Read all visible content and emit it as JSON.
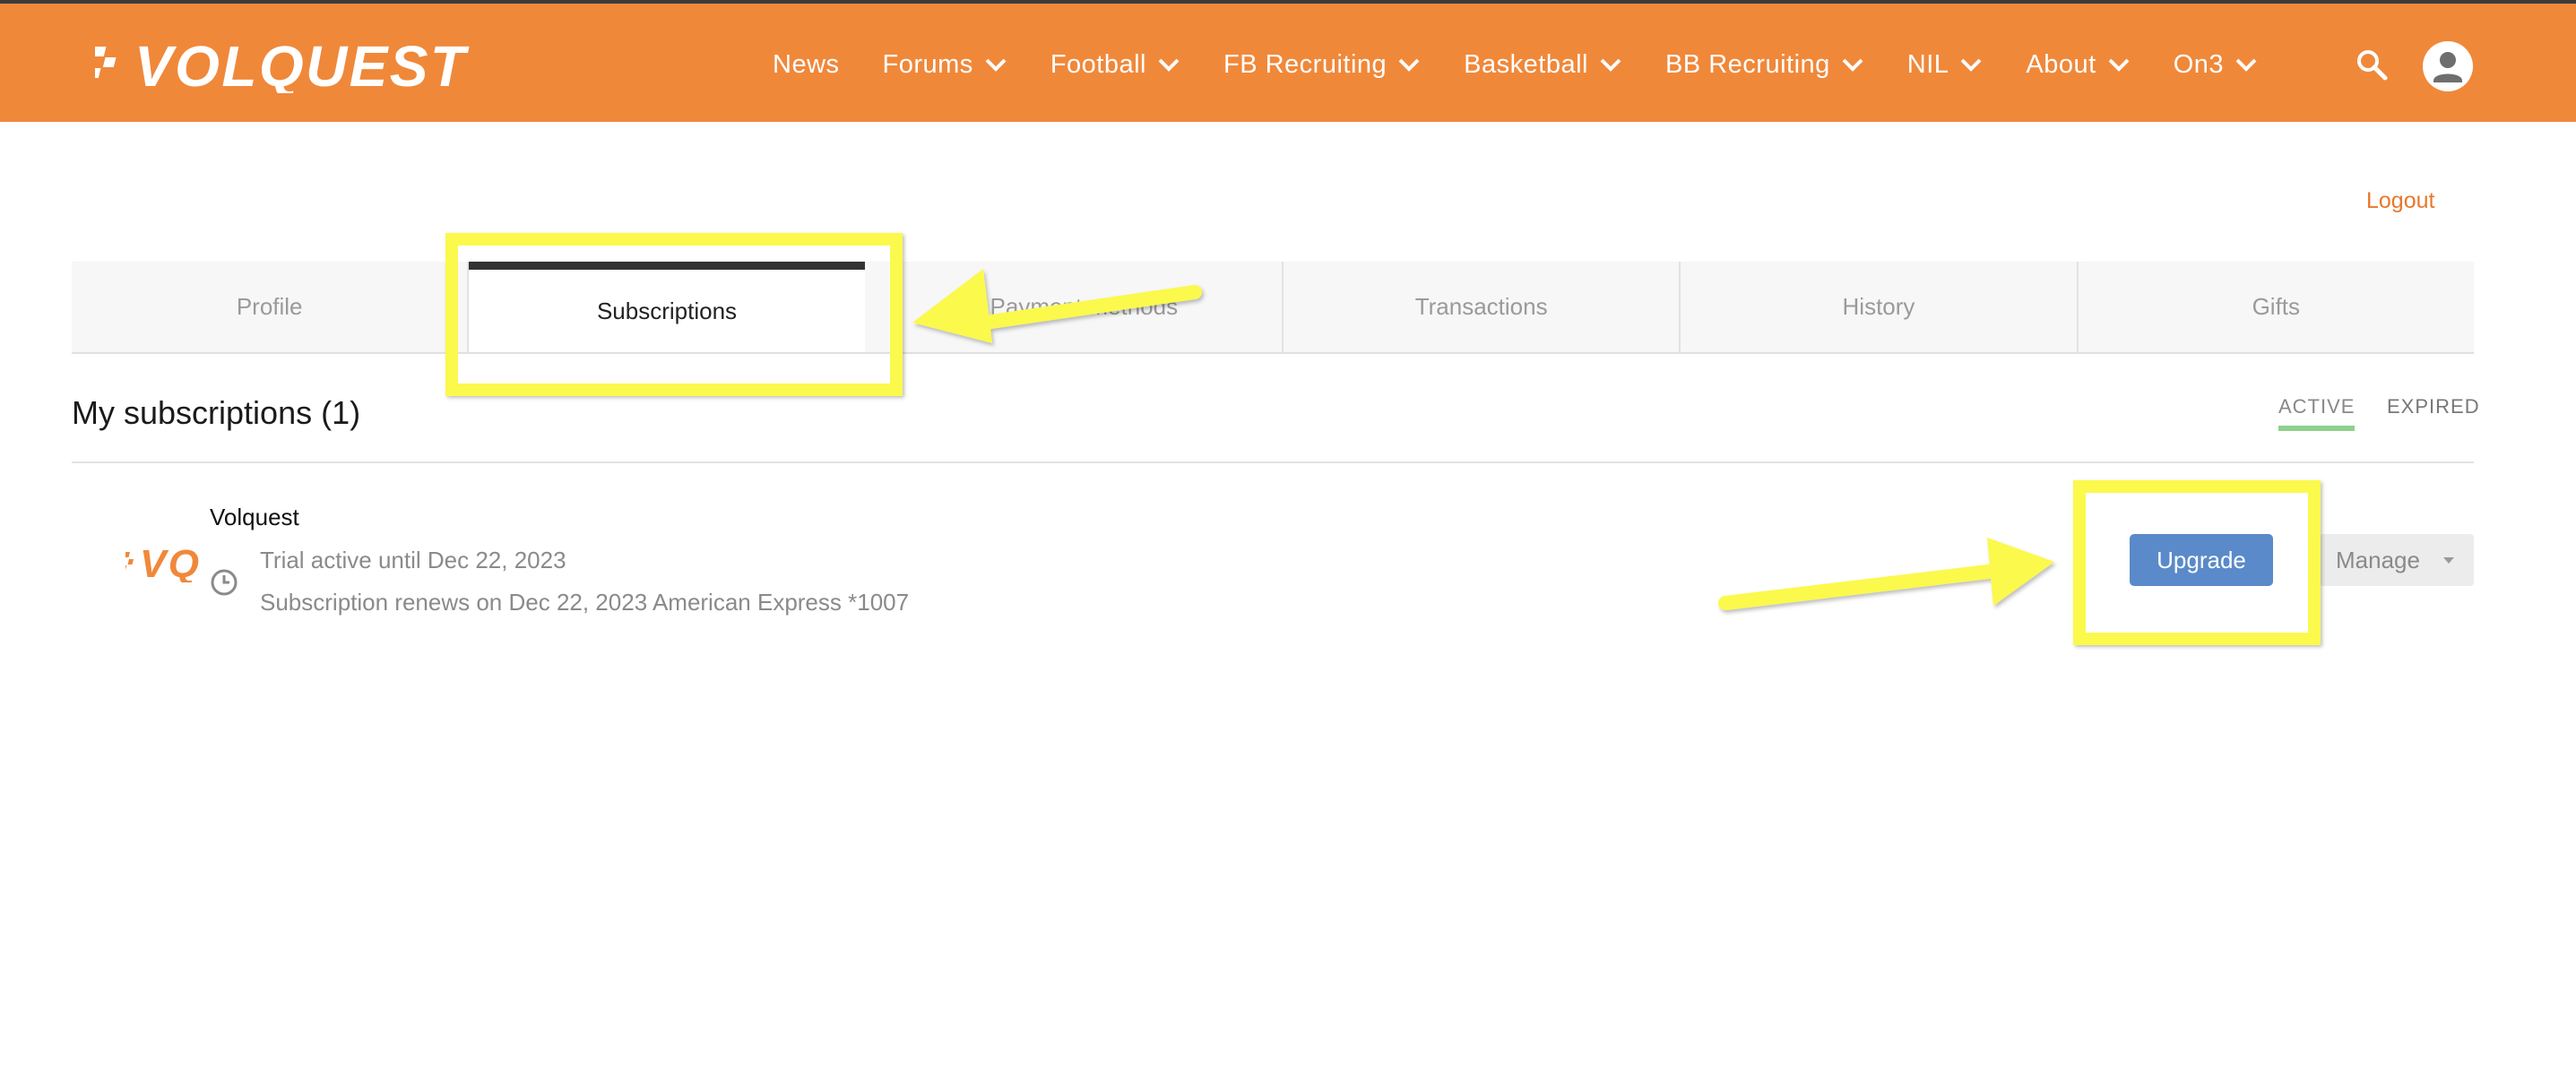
{
  "brand": {
    "logo_text": "VOLQUEST",
    "accent_color": "#f0883a",
    "link_color": "#e8782c"
  },
  "nav": {
    "items": [
      {
        "label": "News",
        "dropdown": false
      },
      {
        "label": "Forums",
        "dropdown": true
      },
      {
        "label": "Football",
        "dropdown": true
      },
      {
        "label": "FB Recruiting",
        "dropdown": true
      },
      {
        "label": "Basketball",
        "dropdown": true
      },
      {
        "label": "BB Recruiting",
        "dropdown": true
      },
      {
        "label": "NIL",
        "dropdown": true
      },
      {
        "label": "About",
        "dropdown": true
      },
      {
        "label": "On3",
        "dropdown": true
      }
    ],
    "search_icon": "search-icon",
    "account_icon": "user-avatar-icon"
  },
  "account": {
    "logout_label": "Logout"
  },
  "tabs": {
    "items": [
      {
        "label": "Profile",
        "active": false
      },
      {
        "label": "Subscriptions",
        "active": true
      },
      {
        "label": "Payment methods",
        "active": false
      },
      {
        "label": "Transactions",
        "active": false
      },
      {
        "label": "History",
        "active": false
      },
      {
        "label": "Gifts",
        "active": false
      }
    ]
  },
  "subscriptions": {
    "title": "My subscriptions (1)",
    "filters": {
      "active": "ACTIVE",
      "expired": "EXPIRED"
    },
    "items": [
      {
        "name": "Volquest",
        "logo_text": "VQ",
        "trial_text": "Trial active until Dec 22, 2023",
        "renew_text": "Subscription renews on Dec 22, 2023 American Express *1007",
        "upgrade_label": "Upgrade",
        "manage_label": "Manage"
      }
    ]
  },
  "annotations": {
    "highlight_color": "#fbf94c"
  }
}
